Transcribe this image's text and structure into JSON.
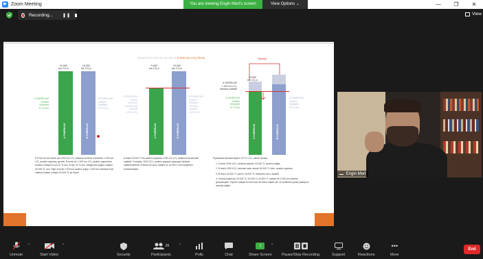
{
  "window": {
    "title": "Zoom Meeting",
    "viewing_banner": "You are viewing Engin Mert's screen",
    "view_options": "View Options ⌄",
    "min": "—",
    "max": "❐",
    "close": "✕"
  },
  "recording": {
    "label": "Recording...",
    "pause": "❚❚",
    "view_label": "View"
  },
  "slide": {
    "heading_prefix": "EMISYON TAVANI OLARAK",
    "heading_value": "9.000 ton CO₂/Tesis",
    "chart1": {
      "bar_a_value": "10.000\nton CO₂e",
      "bar_b_value": "10.000\nton CO₂e",
      "bar_a_name": "A FABRİKASI",
      "bar_b_name": "B FABRİKASI",
      "a_side": "A FABRİKASI\nAzaltım\nMaaliyeti\n10 TL/ton",
      "b_side": "B FABRİKASI\nAzaltım\nMaaliyeti\n20 TL/ton"
    },
    "chart2": {
      "bar_a_value": "9.000\nton CO₂e",
      "bar_b_value": "10.000\nton CO₂e",
      "bar_a_name": "A FABRİKASI",
      "bar_b_name": "B FABRİKASI",
      "a_side": "A FABRİKASI\nAzaltım\nMaaliyeti\nSatabileceği\ntahsisat\n1000 tCO₂",
      "b_side": "B FABRİKASI\nAzaltım\nMaaliyeti\nGereksiz\ntahsisat\n1000 tCO₂"
    },
    "chart3": {
      "tahsisat": "Tahsisat",
      "bar_a_value": "10.000\nton CO₂e",
      "bar_a_name": "A FABRİKASI",
      "bar_b_name": "B FABRİKASI",
      "a_side": "A FABRİKASI\n1.000 ton CO₂\ntahsisat satabilir",
      "a_side2": "A FABRİKASI\nAzaltım\nMaaliyeti\n10 TL/ton",
      "b_side": "B FABRİKASI\nAzaltım\nMaaliyeti\n20 TL/ton"
    },
    "text_left": "ETS'de her iki tesise de 9.000 ton CO₂ tahsisat verilirse A tesisinin 1.000 ton CO₂ azaltım yapması gerekir. B tesisi de 1.000 ton CO₂ azaltım yapmalıdır. Azaltım maliyeti A için 10 TL/ton, B için 20 TL/ton olduğunda toplam maliyet 30.000 TL olur. Eğer A tesisi 2.000 ton azaltım yapıp 1.000 ton tahsisatı B'ye satarsa toplam maliyet 20.000 TL'ye düşer.",
    "text_mid": "A tesisi 20.000 TL'lik azaltım yaparak 2.000 ton CO₂ azaltımında tahsisat satabilir. Fazladan 1000 tCO₂ azaltım yaparak piyasaya tahsisat satabilmektedir. B tesisi ise bunu alabilir ve 10.000 TL'lik maliyetten kurtulmaktadır.",
    "text_right_title": "Piyasadaki tahsisat fiyatını 15 TL/ CO₂ olarak alırsak;",
    "text_right_items": [
      "1. A tesisi 1000 tCO₂ tahsisat satarak 15.000 TL kazanç sağlar.",
      "2. B tesisi 1000 tCO₂ tahsisat satın alarak 15.000 TL öder, azaltım yapmaz.",
      "3. B tesisi 10.000 TL yerine 15.000 TL ödeyerek sınırı aşabilir.",
      "4. A tesisi kaybında 20.000 TL-15.000 TL=5.000 TL maliyet ile 2.000 ton azaltım gerçekleştirir. Toplam maliyet iki tesis için de daha düşük olur ve analizde piyasa yaklaşımı avantaj sağlar."
    ]
  },
  "video": {
    "participant_name": "Engin Mert"
  },
  "toolbar": {
    "unmute": "Unmute",
    "start_video": "Start Video",
    "security": "Security",
    "participants": "Participants",
    "participants_count": "28",
    "polls": "Polls",
    "chat": "Chat",
    "share_screen": "Share Screen",
    "pause_stop_recording": "Pause/Stop Recording",
    "support": "Support",
    "reactions": "Reactions",
    "more": "More",
    "end": "End"
  },
  "colors": {
    "green_bar": "#3aa54a",
    "blue_bar": "#8c9fcd",
    "orange": "#e2742b",
    "share_green": "#3cb043",
    "end_red": "#e02828"
  }
}
